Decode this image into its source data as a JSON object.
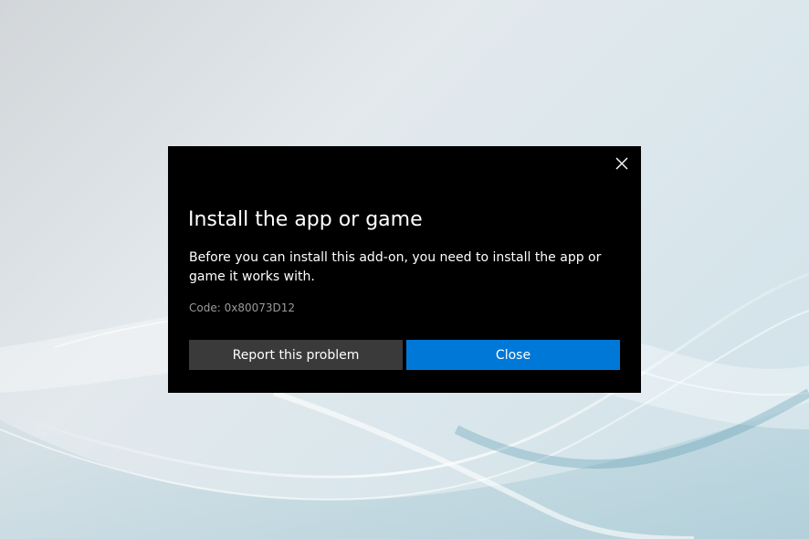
{
  "dialog": {
    "title": "Install the app or game",
    "message": "Before you can install this add-on, you need to install the app or game it works with.",
    "code": "Code: 0x80073D12",
    "close_icon": "close-icon",
    "buttons": {
      "report_label": "Report this problem",
      "close_label": "Close"
    }
  },
  "colors": {
    "dialog_background": "#000000",
    "primary_button": "#0078d7",
    "secondary_button": "#3a3a3a",
    "code_text": "#9a9a9a"
  }
}
